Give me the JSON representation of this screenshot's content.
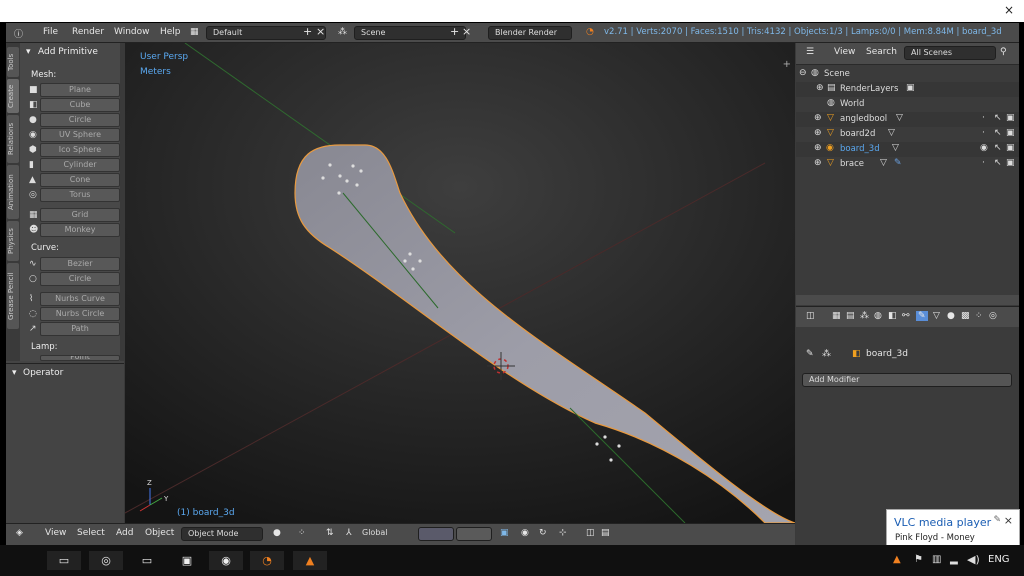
{
  "window": {
    "close_glyph": "×"
  },
  "infobar": {
    "menus": [
      "File",
      "Render",
      "Window",
      "Help"
    ],
    "layout": "Default",
    "scene": "Scene",
    "engine": "Blender Render",
    "stats": "v2.71 | Verts:2070 | Faces:1510 | Tris:4132 | Objects:1/3 | Lamps:0/0 | Mem:8.84M | board_3d"
  },
  "toolshelf": {
    "tabs": [
      "Tools",
      "Create",
      "Relations",
      "Animation",
      "Physics",
      "Grease Pencil"
    ],
    "panel_title": "Add Primitive",
    "mesh_label": "Mesh:",
    "mesh": [
      "Plane",
      "Cube",
      "Circle",
      "UV Sphere",
      "Ico Sphere",
      "Cylinder",
      "Cone",
      "Torus",
      "Grid",
      "Monkey"
    ],
    "curve_label": "Curve:",
    "curve": [
      "Bezier",
      "Circle",
      "Nurbs Curve",
      "Nurbs Circle",
      "Path"
    ],
    "lamp_label": "Lamp:",
    "lamp_first": "Point",
    "operator": "Operator"
  },
  "viewport": {
    "view_label": "User Persp",
    "units_label": "Meters",
    "object_label": "(1) board_3d",
    "axis_z": "Z",
    "axis_y": "Y"
  },
  "bottombar": {
    "menus": [
      "View",
      "Select",
      "Add",
      "Object"
    ],
    "mode": "Object Mode",
    "orientation": "Global"
  },
  "outliner": {
    "view": "View",
    "search": "Search",
    "filter": "All Scenes",
    "items": [
      {
        "label": "Scene"
      },
      {
        "label": "RenderLayers"
      },
      {
        "label": "World"
      },
      {
        "label": "angledbool"
      },
      {
        "label": "board2d"
      },
      {
        "label": "board_3d"
      },
      {
        "label": "brace"
      }
    ]
  },
  "properties": {
    "object": "board_3d",
    "add_modifier": "Add Modifier"
  },
  "vlc": {
    "title": "VLC media player",
    "track": "Pink Floyd - Money"
  },
  "taskbar": {
    "lang": "ENG"
  },
  "colors": {
    "accent": "#5aa8f0",
    "selected": "#f0a020",
    "board": "#9b9ba6"
  }
}
